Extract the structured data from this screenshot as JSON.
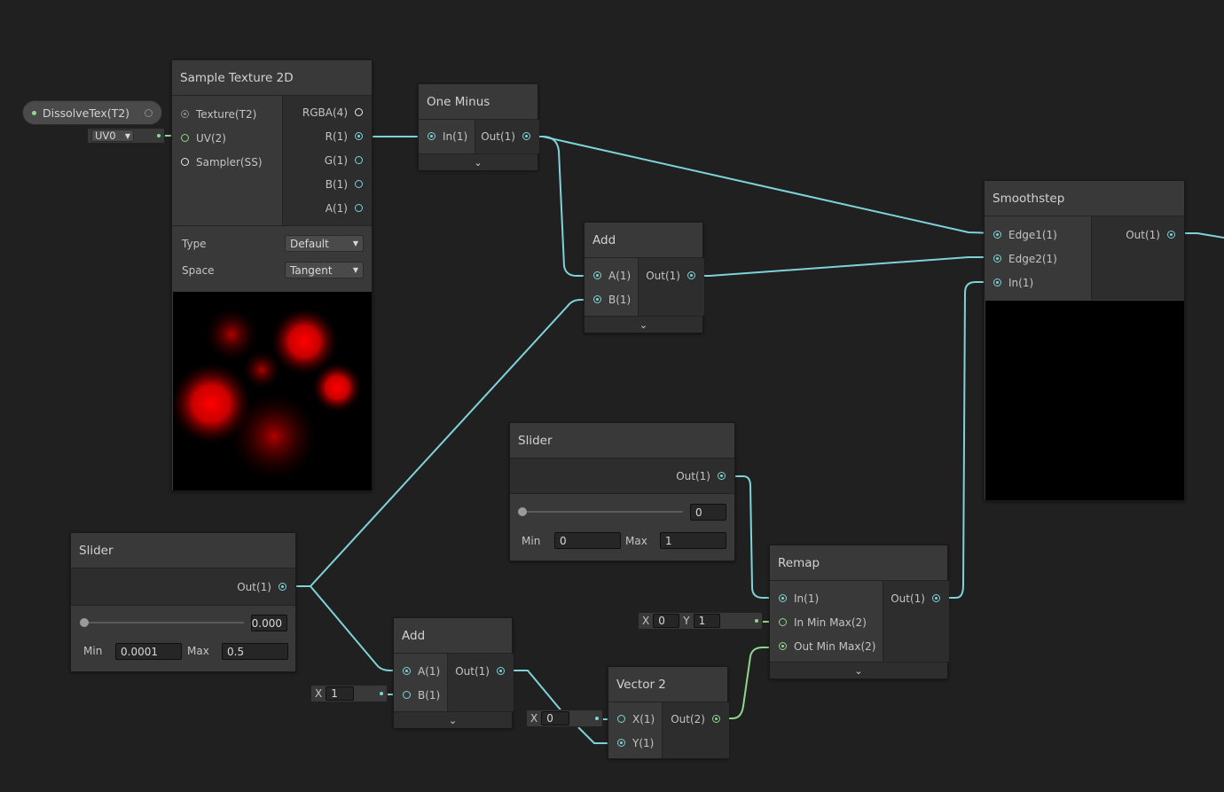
{
  "colors": {
    "background": "#202020",
    "wire_float": "#7fd3d8",
    "wire_vector2": "#90d58f",
    "node_bg": "#3a3a3a"
  },
  "property_node": {
    "label": "DissolveTex(T2)"
  },
  "uv_dropdown": {
    "value": "UV0"
  },
  "sample_texture": {
    "title": "Sample Texture 2D",
    "inputs": [
      "Texture(T2)",
      "UV(2)",
      "Sampler(SS)"
    ],
    "outputs": [
      "RGBA(4)",
      "R(1)",
      "G(1)",
      "B(1)",
      "A(1)"
    ],
    "type_label": "Type",
    "type_value": "Default",
    "space_label": "Space",
    "space_value": "Tangent"
  },
  "one_minus": {
    "title": "One Minus",
    "input": "In(1)",
    "output": "Out(1)"
  },
  "add_top": {
    "title": "Add",
    "inputs": [
      "A(1)",
      "B(1)"
    ],
    "output": "Out(1)"
  },
  "smoothstep": {
    "title": "Smoothstep",
    "inputs": [
      "Edge1(1)",
      "Edge2(1)",
      "In(1)"
    ],
    "output": "Out(1)"
  },
  "slider_mid": {
    "title": "Slider",
    "output": "Out(1)",
    "value": "0",
    "min_label": "Min",
    "min": "0",
    "max_label": "Max",
    "max": "1",
    "position": 0
  },
  "slider_left": {
    "title": "Slider",
    "output": "Out(1)",
    "value": "0.000",
    "min_label": "Min",
    "min": "0.0001",
    "max_label": "Max",
    "max": "0.5",
    "position": 0
  },
  "remap": {
    "title": "Remap",
    "inputs": [
      "In(1)",
      "In Min Max(2)",
      "Out Min Max(2)"
    ],
    "output": "Out(1)",
    "in_min_max": {
      "x_label": "X",
      "x": "0",
      "y_label": "Y",
      "y": "1"
    }
  },
  "add_bottom": {
    "title": "Add",
    "inputs": [
      "A(1)",
      "B(1)"
    ],
    "output": "Out(1)",
    "b_default": {
      "x_label": "X",
      "x": "1"
    }
  },
  "vector2": {
    "title": "Vector 2",
    "inputs": [
      "X(1)",
      "Y(1)"
    ],
    "output": "Out(2)",
    "x_default": {
      "x_label": "X",
      "x": "0"
    }
  }
}
